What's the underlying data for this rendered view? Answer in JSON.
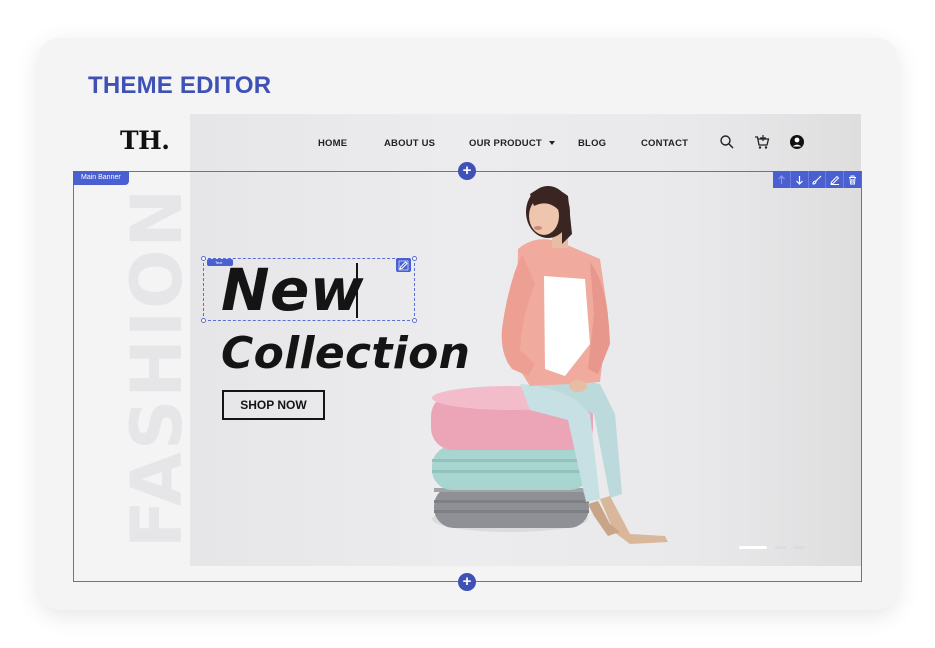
{
  "editor": {
    "title": "THEME EDITOR"
  },
  "site": {
    "logo": "TH.",
    "nav": [
      "HOME",
      "ABOUT US",
      "OUR PRODUCT",
      "BLOG",
      "CONTACT"
    ]
  },
  "banner": {
    "tag": "Main Banner",
    "side_text": "FASHION",
    "headline_1": "New",
    "headline_2": "Collection",
    "cta": "SHOP NOW",
    "text_tag": "Text"
  },
  "icons": [
    "search-icon",
    "cart-icon",
    "user-icon",
    "move-up-icon",
    "move-down-icon",
    "brush-icon",
    "edit-icon",
    "delete-icon",
    "plus-icon"
  ],
  "colors": {
    "accent": "#3f51b5",
    "selection": "#5a6fd6",
    "text": "#141414"
  },
  "slider": {
    "active_index": 0,
    "count": 3
  }
}
